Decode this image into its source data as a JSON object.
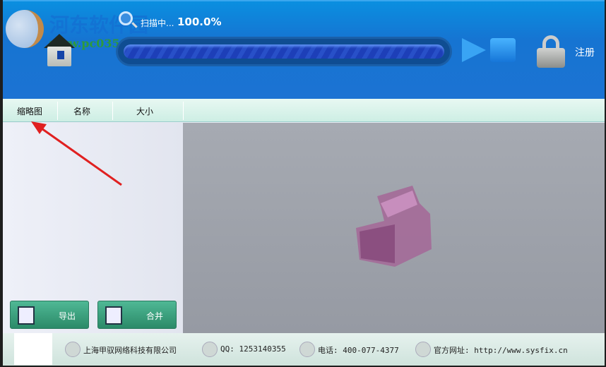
{
  "watermark": {
    "site": "河东软件园",
    "url": "www.pc0359.cn"
  },
  "header": {
    "scan_label": "扫描中...",
    "progress_text": "100.0%",
    "progress": 1.0,
    "register_label": "注册"
  },
  "columns": [
    "缩略图",
    "名称",
    "大小"
  ],
  "buttons": {
    "export": "导出",
    "merge": "合并"
  },
  "footer": {
    "company": "上海甲驭网络科技有限公司",
    "qq": "QQ: 1253140355",
    "phone": "电话: 400-077-4377",
    "website": "官方网址: http://www.sysfix.cn"
  },
  "colors": {
    "header": "#1c73d3",
    "button": "#3a9e7c",
    "arrow": "#e02020"
  }
}
